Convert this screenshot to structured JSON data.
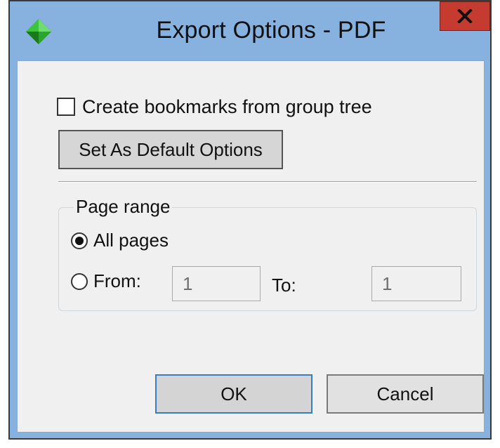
{
  "window": {
    "title": "Export Options - PDF",
    "icon": "green-diamond-icon",
    "close_icon": "close-icon"
  },
  "options": {
    "bookmarks_label": "Create bookmarks from group tree",
    "bookmarks_checked": false,
    "set_default_label": "Set As Default Options"
  },
  "page_range": {
    "legend": "Page range",
    "all_pages_label": "All pages",
    "all_pages_selected": true,
    "from_label": "From:",
    "from_selected": false,
    "from_value": "1",
    "to_label": "To:",
    "to_value": "1"
  },
  "buttons": {
    "ok_label": "OK",
    "cancel_label": "Cancel"
  },
  "colors": {
    "frame": "#87b1df",
    "close": "#c53b30",
    "client": "#f0f0f0",
    "icon_green": "#2fb52f"
  }
}
